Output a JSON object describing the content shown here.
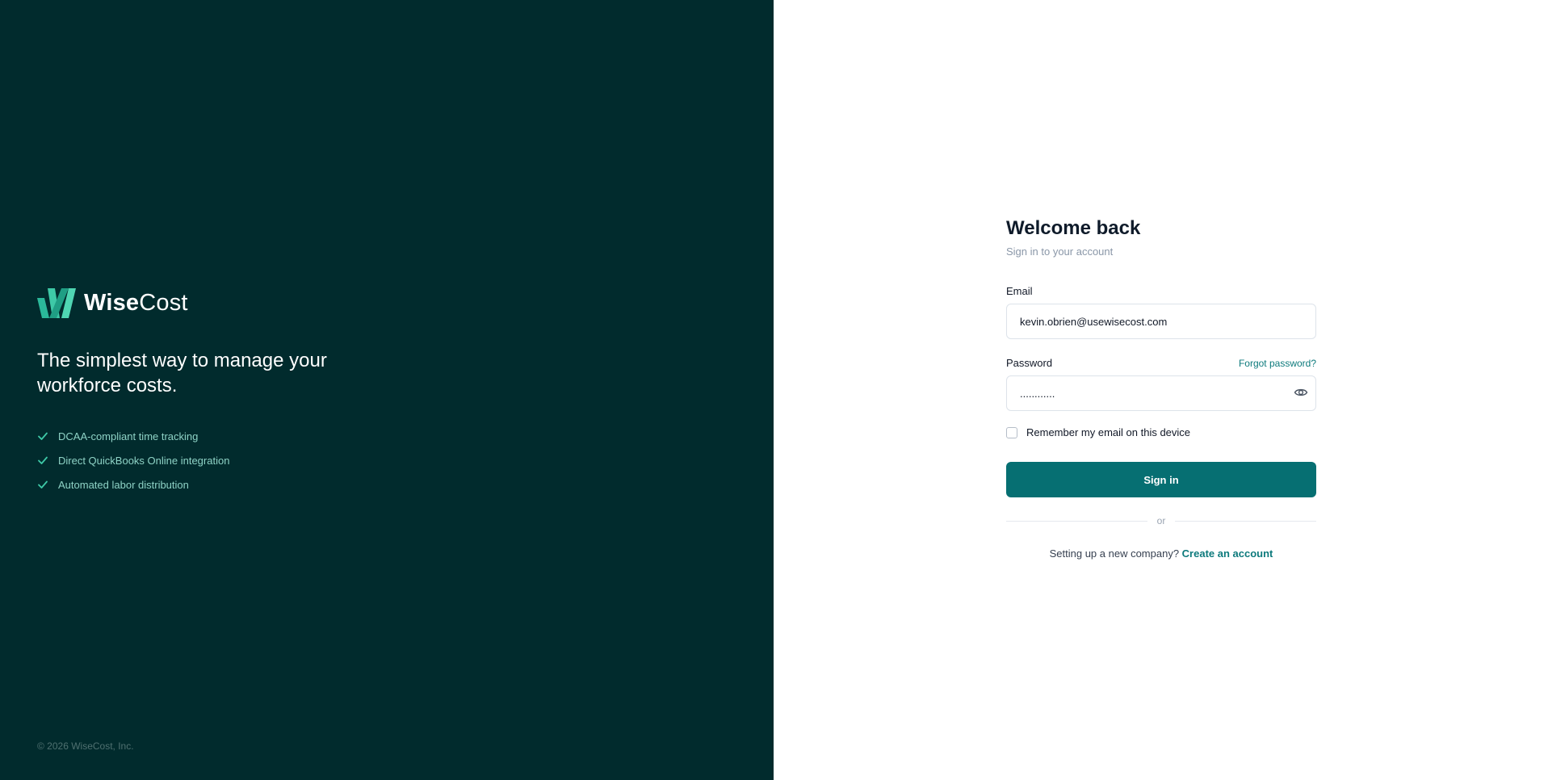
{
  "brand": {
    "name_part1": "Wise",
    "name_part2": "Cost",
    "logo_icon": "wisecost-logo-icon",
    "accent_color": "#3ec9a7"
  },
  "hero": {
    "tagline": "The simplest way to manage your workforce costs.",
    "features": [
      "DCAA-compliant time tracking",
      "Direct QuickBooks Online integration",
      "Automated labor distribution"
    ],
    "feature_icon": "check-icon"
  },
  "footer": {
    "copyright": "© 2026 WiseCost, Inc."
  },
  "form": {
    "title": "Welcome back",
    "subtitle": "Sign in to your account",
    "email_label": "Email",
    "email_value": "kevin.obrien@usewisecost.com",
    "password_label": "Password",
    "forgot_link": "Forgot password?",
    "password_value": "............",
    "password_icon": "eye-icon",
    "remember_label": "Remember my email on this device",
    "remember_checked": false,
    "signin_label": "Sign in",
    "divider_text": "or",
    "signup_prompt": "Setting up a new company?",
    "signup_link": "Create an account"
  },
  "colors": {
    "left_background": "#012b2d",
    "primary_button": "#066f72",
    "link": "#0d7a7c",
    "feature_text": "#8fd3c6"
  }
}
